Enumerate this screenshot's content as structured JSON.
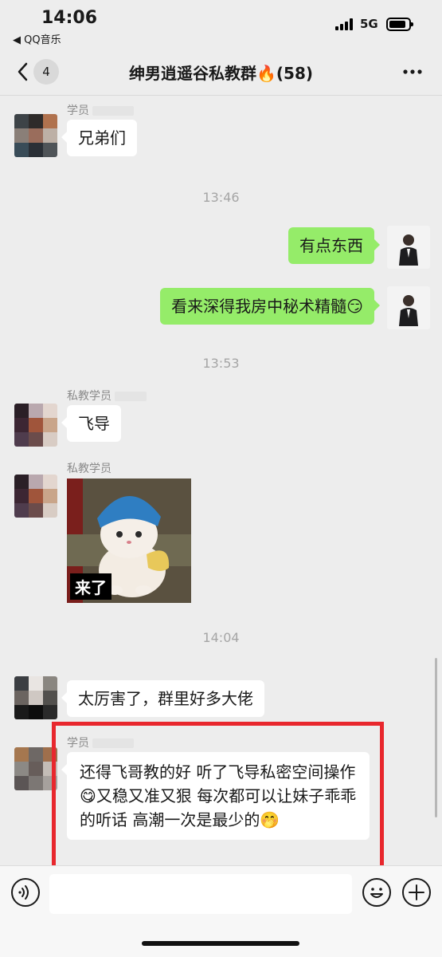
{
  "status_bar": {
    "time": "14:06",
    "back_app": "◀ QQ音乐",
    "network": "5G"
  },
  "nav": {
    "unread_count": "4",
    "title": "绅男逍遥谷私教群🔥(58)"
  },
  "messages": [
    {
      "sender": "学员",
      "text": "兄弟们"
    },
    {
      "timestamp": "13:46"
    },
    {
      "sender": "me",
      "text": "有点东西"
    },
    {
      "sender": "me",
      "text": "看来深得我房中秘术精髓😏"
    },
    {
      "timestamp": "13:53"
    },
    {
      "sender": "私教学员",
      "text": "飞导"
    },
    {
      "sender": "私教学员",
      "sticker_caption": "来了"
    },
    {
      "timestamp": "14:04"
    },
    {
      "sender": "",
      "text": "太厉害了，群里好多大佬"
    },
    {
      "sender": "学员",
      "text": "还得飞哥教的好 听了飞导私密空间操作😋又稳又准又狠 每次都可以让妹子乖乖的听话 高潮一次是最少的🤭"
    }
  ],
  "colors": {
    "outgoing_bubble": "#95ec69",
    "highlight": "#e8272d"
  },
  "icons": {
    "voice": "voice-icon",
    "emoji": "emoji-icon",
    "plus": "plus-icon",
    "back": "chevron-left-icon",
    "more": "more-icon"
  }
}
